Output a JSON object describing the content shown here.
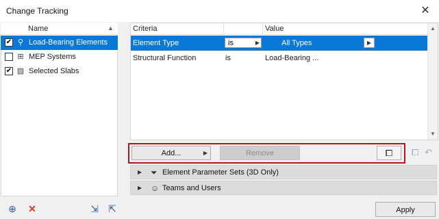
{
  "window": {
    "title": "Change Tracking",
    "close_glyph": "✕"
  },
  "left_list": {
    "header": "Name",
    "items": [
      {
        "label": "Load-Bearing Elements",
        "checked": true,
        "icon": "magnifier-icon",
        "selected": true
      },
      {
        "label": "MEP Systems",
        "checked": false,
        "icon": "mep-icon",
        "selected": false
      },
      {
        "label": "Selected Slabs",
        "checked": true,
        "icon": "slab-icon",
        "selected": false
      }
    ],
    "footer_icons": [
      "add-criteria-set-icon",
      "delete-icon",
      "import-icon",
      "export-icon"
    ]
  },
  "criteria_table": {
    "columns": [
      "Criteria",
      "",
      "Value"
    ],
    "rows": [
      {
        "criteria": "Element Type",
        "operator": "is",
        "value": "All Types",
        "selected": true
      },
      {
        "criteria": "Structural Function",
        "operator": "is",
        "value": "Load-Bearing ...",
        "selected": false
      }
    ]
  },
  "toolbar": {
    "add_label": "Add...",
    "remove_label": "Remove"
  },
  "sections": [
    {
      "label": "Element Parameter Sets (3D Only)",
      "icon": "filter-icon"
    },
    {
      "label": "Teams and Users",
      "icon": "user-icon"
    }
  ],
  "footer": {
    "apply_label": "Apply"
  },
  "colors": {
    "selection": "#0a78d7",
    "highlight_box": "#b5121b",
    "delete": "#e03a1e"
  }
}
